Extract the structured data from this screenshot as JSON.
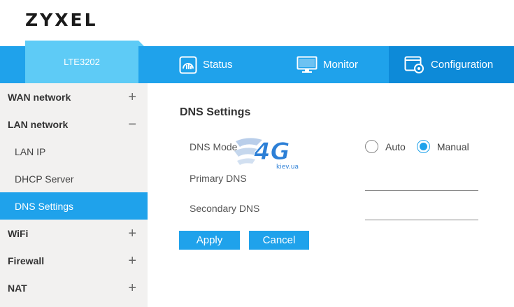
{
  "brand": {
    "logo": "ZYXEL"
  },
  "device_tab": {
    "label": "LTE3202"
  },
  "nav": {
    "status": {
      "label": "Status",
      "icon": "status-gauge-icon"
    },
    "monitor": {
      "label": "Monitor",
      "icon": "monitor-icon"
    },
    "configuration": {
      "label": "Configuration",
      "icon": "configuration-gear-icon"
    }
  },
  "sidebar": {
    "wan": {
      "label": "WAN network",
      "toggle": "+"
    },
    "lan": {
      "label": "LAN network",
      "toggle": "−"
    },
    "lan_ip": {
      "label": "LAN IP"
    },
    "dhcp": {
      "label": "DHCP Server"
    },
    "dns": {
      "label": "DNS Settings"
    },
    "wifi": {
      "label": "WiFi",
      "toggle": "+"
    },
    "firewall": {
      "label": "Firewall",
      "toggle": "+"
    },
    "nat": {
      "label": "NAT",
      "toggle": "+"
    }
  },
  "dns_settings": {
    "title": "DNS Settings",
    "mode_label": "DNS Mode",
    "mode_auto": "Auto",
    "mode_manual": "Manual",
    "mode_selected": "Manual",
    "primary_label": "Primary DNS",
    "primary_value": "",
    "secondary_label": "Secondary DNS",
    "secondary_value": "",
    "apply": "Apply",
    "cancel": "Cancel"
  },
  "watermark": {
    "main": "4G",
    "sub": "kiev.ua"
  },
  "colors": {
    "accent": "#1fa2eb",
    "accent_dark": "#0d8ad8",
    "tab_light": "#5ecbf6",
    "sidebar_bg": "#f2f1f0"
  }
}
